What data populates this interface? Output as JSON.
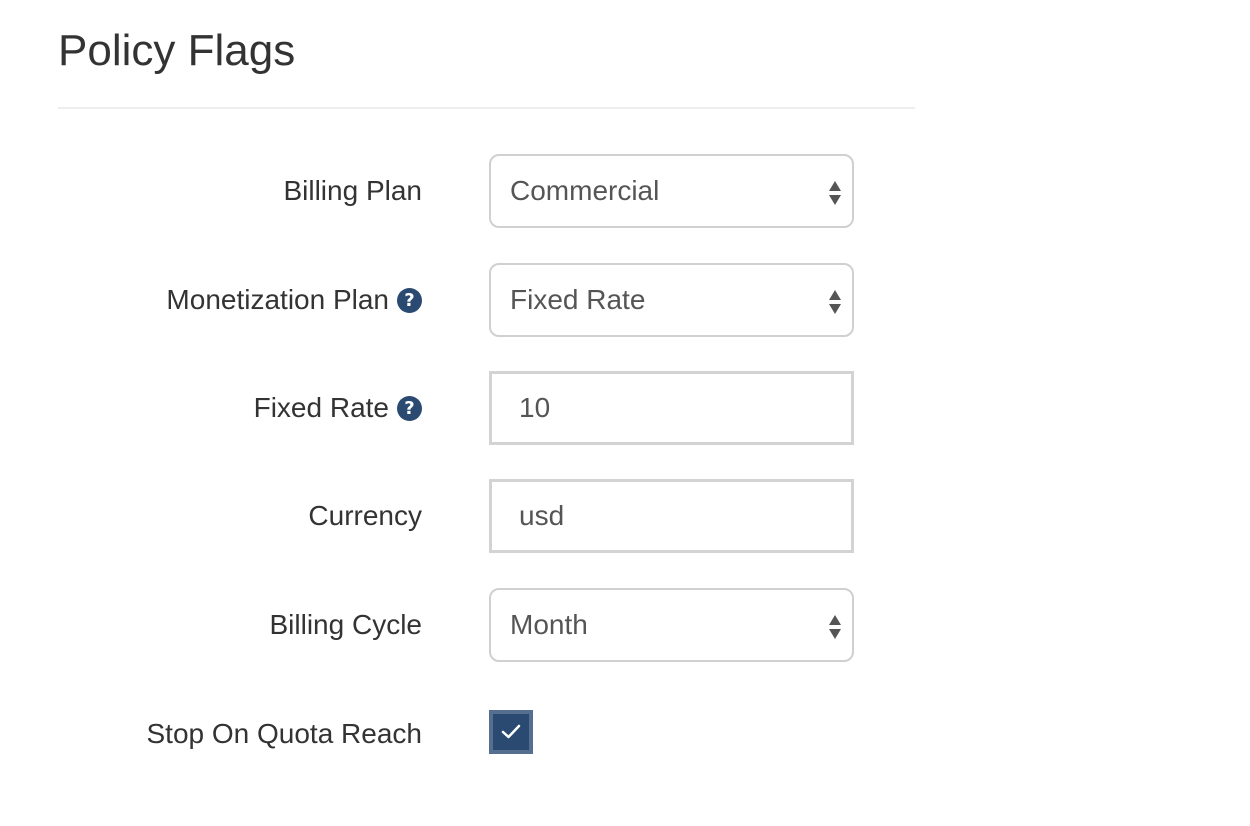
{
  "section": {
    "title": "Policy Flags"
  },
  "form": {
    "billing_plan": {
      "label": "Billing Plan",
      "value": "Commercial"
    },
    "monetization_plan": {
      "label": "Monetization Plan",
      "help_icon": "question-circle-icon",
      "value": "Fixed Rate"
    },
    "fixed_rate": {
      "label": "Fixed Rate",
      "help_icon": "question-circle-icon",
      "value": "10"
    },
    "currency": {
      "label": "Currency",
      "value": "usd"
    },
    "billing_cycle": {
      "label": "Billing Cycle",
      "value": "Month"
    },
    "stop_on_quota_reach": {
      "label": "Stop On Quota Reach",
      "checked": true,
      "icon": "checkmark-icon"
    }
  },
  "colors": {
    "accent": "#2a4a72",
    "help_icon": "#2a4a72",
    "input_border": "#d0d0d0",
    "divider": "#eeeeee"
  }
}
